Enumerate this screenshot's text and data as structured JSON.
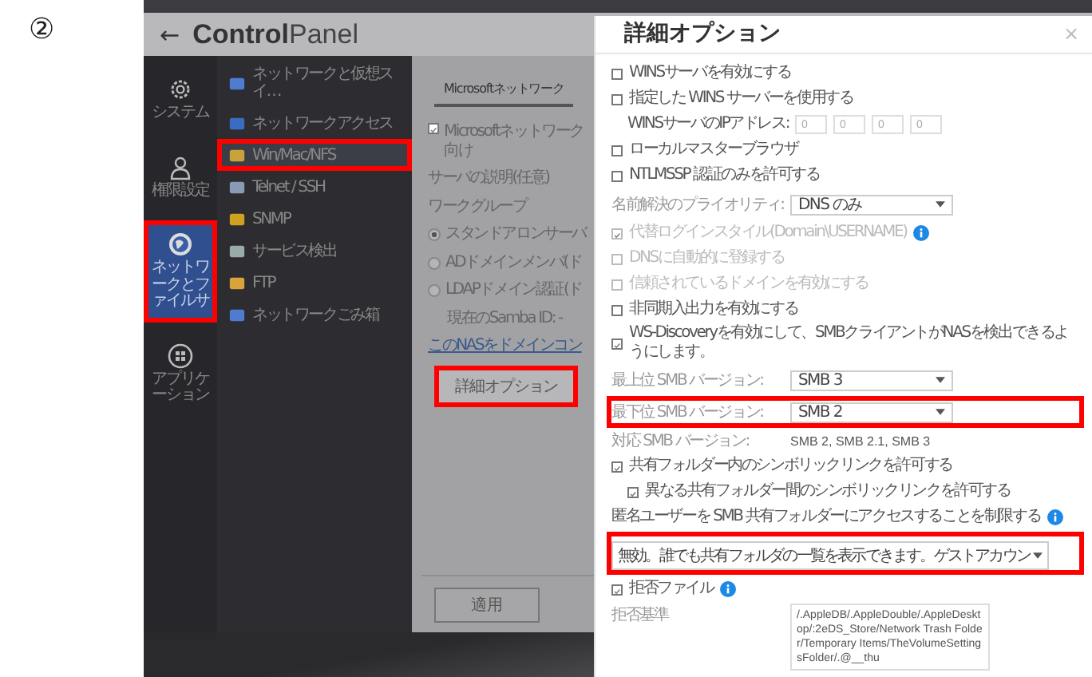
{
  "annotation": {
    "step": "②"
  },
  "app": {
    "back": "←",
    "title": "**Control**Panel"
  },
  "main_nav": [
    {
      "label": "システム",
      "selected": false,
      "highlighted": false
    },
    {
      "label": "権限設定",
      "selected": false,
      "highlighted": false
    },
    {
      "label": "ネットワークとファイルサ",
      "selected": true,
      "highlighted": true
    },
    {
      "label": "アプリケーション",
      "selected": false,
      "highlighted": false
    }
  ],
  "sub_nav": [
    {
      "label": "ネットワークと仮想スイ…",
      "selected": false,
      "highlighted": false
    },
    {
      "label": "ネットワークアクセス",
      "selected": false,
      "highlighted": false
    },
    {
      "label": "Win/Mac/NFS",
      "selected": true,
      "highlighted": true
    },
    {
      "label": "Telnet / SSH",
      "selected": false,
      "highlighted": false
    },
    {
      "label": "SNMP",
      "selected": false,
      "highlighted": false
    },
    {
      "label": "サービス検出",
      "selected": false,
      "highlighted": false
    },
    {
      "label": "FTP",
      "selected": false,
      "highlighted": false
    },
    {
      "label": "ネットワークごみ箱",
      "selected": false,
      "highlighted": false
    }
  ],
  "content": {
    "tab": {
      "label": "Microsoftネットワーク",
      "selected": true
    },
    "items": [
      {
        "kind": "checkbox",
        "label": "Microsoftネットワーク向け",
        "checked": true
      },
      {
        "kind": "text",
        "label": "サーバの説明(任意)"
      },
      {
        "kind": "text",
        "label": "ワークグループ"
      },
      {
        "kind": "radio",
        "label": "スタンドアロンサーバ",
        "selected": true
      },
      {
        "kind": "radio",
        "label": "ADドメインメンバ(ド",
        "selected": false
      },
      {
        "kind": "radio",
        "label": "LDAPドメイン認証(ド",
        "selected": false
      },
      {
        "kind": "note",
        "label": "現在のSamba ID: -"
      },
      {
        "kind": "link",
        "label": "このNASをドメインコン"
      }
    ],
    "advanced_button": {
      "label": "詳細オプション",
      "highlighted": true
    },
    "apply_button": "適用"
  },
  "dialog": {
    "title": "詳細オプション",
    "close": "×",
    "options": [
      {
        "kind": "checkbox",
        "label": "WINSサーバを有効にする",
        "checked": false,
        "disabled": false
      },
      {
        "kind": "checkbox",
        "label": "指定した WINS サーバーを使用する",
        "checked": false,
        "disabled": false,
        "children": [
          {
            "kind": "ip",
            "label": "WINSサーバのIPアドレス:",
            "octets": [
              "0",
              "0",
              "0",
              "0"
            ]
          }
        ]
      },
      {
        "kind": "checkbox",
        "label": "ローカルマスターブラウザ",
        "checked": false,
        "disabled": false
      },
      {
        "kind": "checkbox",
        "label": "NTLMSSP 認証のみを許可する",
        "checked": false,
        "disabled": false
      },
      {
        "kind": "select",
        "label": "名前解決のプライオリティ:",
        "value": "DNS のみ",
        "highlighted": false
      },
      {
        "kind": "checkbox",
        "label": "代替ログインスタイル(Domain\\USERNAME)",
        "checked": true,
        "disabled": true,
        "info": true
      },
      {
        "kind": "checkbox",
        "label": "DNSに自動的に登録する",
        "checked": false,
        "disabled": true
      },
      {
        "kind": "checkbox",
        "label": "信頼されているドメインを有効にする",
        "checked": false,
        "disabled": true
      },
      {
        "kind": "checkbox",
        "label": "非同期入出力を有効にする",
        "checked": false,
        "disabled": false
      },
      {
        "kind": "checkbox",
        "label": "WS-Discoveryを有効にして、SMBクライアントがNASを検出できるようにします。",
        "checked": true,
        "disabled": false
      },
      {
        "kind": "select",
        "label": "最上位 SMB バージョン:",
        "value": "SMB 3",
        "highlighted": false
      },
      {
        "kind": "select",
        "label": "最下位 SMB バージョン:",
        "value": "SMB 2",
        "highlighted": true
      },
      {
        "kind": "text",
        "label": "対応 SMB バージョン:",
        "value": "SMB 2, SMB 2.1, SMB 3"
      },
      {
        "kind": "checkbox",
        "label": "共有フォルダー内のシンボリックリンクを許可する",
        "checked": true,
        "disabled": false,
        "children": [
          {
            "kind": "checkbox",
            "label": "異なる共有フォルダー間のシンボリックリンクを許可する",
            "checked": true,
            "disabled": false
          }
        ]
      },
      {
        "kind": "label",
        "label": "匿名ユーザーを SMB 共有フォルダーにアクセスすることを制限する",
        "info": true
      },
      {
        "kind": "wide_select",
        "value": "無効。誰でも共有フォルダの一覧を表示できます。ゲストアカウン",
        "highlighted": true
      },
      {
        "kind": "checkbox",
        "label": "拒否ファイル",
        "checked": true,
        "disabled": false,
        "info": true
      },
      {
        "kind": "textarea",
        "label": "拒否基準",
        "value": "/.AppleDB/.AppleDouble/.AppleDesktop/:2eDS_Store/Network Trash Folder/Temporary Items/TheVolumeSettingsFolder/.@__thu"
      }
    ]
  }
}
